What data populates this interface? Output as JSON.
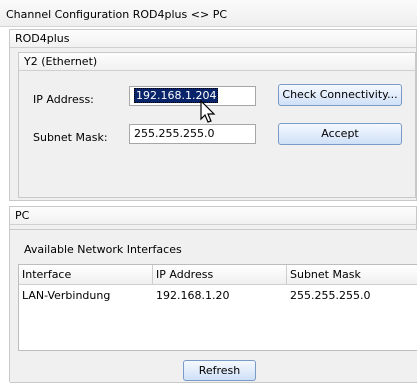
{
  "window": {
    "title": "Channel Configuration ROD4plus <> PC"
  },
  "rod_group": {
    "title": "ROD4plus",
    "ethernet": {
      "title": "Y2 (Ethernet)",
      "ip_label": "IP Address:",
      "ip_value": "192.168.1.204",
      "subnet_label": "Subnet Mask:",
      "subnet_value": "255.255.255.0",
      "check_button": "Check Connectivity...",
      "accept_button": "Accept"
    }
  },
  "pc_group": {
    "title": "PC",
    "interfaces_title": "Available Network Interfaces",
    "columns": [
      "Interface",
      "IP Address",
      "Subnet Mask"
    ],
    "rows": [
      {
        "interface": "LAN-Verbindung",
        "ip": "192.168.1.20",
        "mask": "255.255.255.0"
      }
    ],
    "refresh_button": "Refresh"
  },
  "icons": {
    "cursor": "mouse-pointer-icon"
  }
}
